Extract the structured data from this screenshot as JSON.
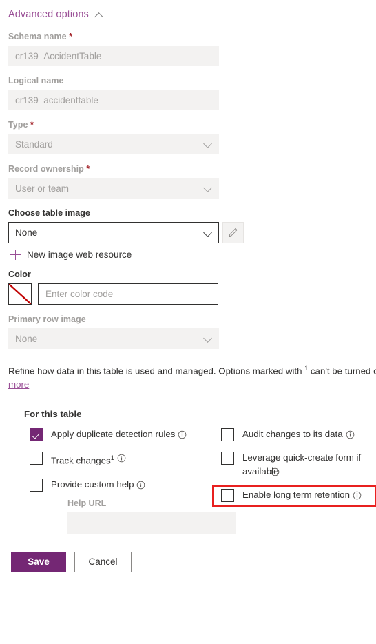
{
  "advanced": {
    "label": "Advanced options",
    "collapse_icon": "chevron-up-icon"
  },
  "fields": {
    "schema_name": {
      "label": "Schema name",
      "required": true,
      "value": "cr139_AccidentTable",
      "disabled": true
    },
    "logical_name": {
      "label": "Logical name",
      "required": false,
      "value": "cr139_accidenttable",
      "disabled": true
    },
    "type": {
      "label": "Type",
      "required": true,
      "value": "Standard",
      "disabled": true
    },
    "record_ownership": {
      "label": "Record ownership",
      "required": true,
      "value": "User or team",
      "disabled": true
    },
    "choose_table_image": {
      "label": "Choose table image",
      "required": false,
      "value": "None",
      "disabled": false,
      "edit_icon": "pencil-icon"
    },
    "new_image_web_resource": {
      "label": "New image web resource",
      "icon": "plus-icon"
    },
    "color": {
      "label": "Color",
      "swatch": "no-color-swatch",
      "placeholder": "Enter color code",
      "value": ""
    },
    "primary_row_image": {
      "label": "Primary row image",
      "required": false,
      "value": "None",
      "disabled": true
    }
  },
  "refine": {
    "text_part1": "Refine how data in this table is used and managed. Options marked with ",
    "superscript": "1",
    "text_part2": " can't be turned off once enabled. ",
    "learn_more": "Learn more"
  },
  "table_panel": {
    "title": "For this table",
    "left_items": [
      {
        "label": "Apply duplicate detection rules",
        "checked": true,
        "info": true,
        "superscript": ""
      },
      {
        "label": "Track changes",
        "checked": false,
        "info": true,
        "superscript": "1"
      },
      {
        "label": "Provide custom help",
        "checked": false,
        "info": true,
        "superscript": ""
      }
    ],
    "right_items": [
      {
        "label": "Audit changes to its data",
        "checked": false,
        "info": true,
        "superscript": "",
        "highlighted": true
      },
      {
        "label": "Leverage quick-create form if available",
        "checked": false,
        "info": true,
        "superscript": ""
      },
      {
        "label": "Enable long term retention",
        "checked": false,
        "info": true,
        "superscript": ""
      }
    ],
    "help_url": {
      "label": "Help URL",
      "value": "",
      "disabled": true
    }
  },
  "footer": {
    "save_label": "Save",
    "cancel_label": "Cancel"
  },
  "colors": {
    "accent_purple": "#9a4f96",
    "brand_purple": "#742774",
    "required_red": "#a4262c",
    "annotation_red": "#e8201f",
    "disabled_bg": "#f3f2f1",
    "disabled_text": "#a19f9d",
    "body_text": "#323130"
  }
}
